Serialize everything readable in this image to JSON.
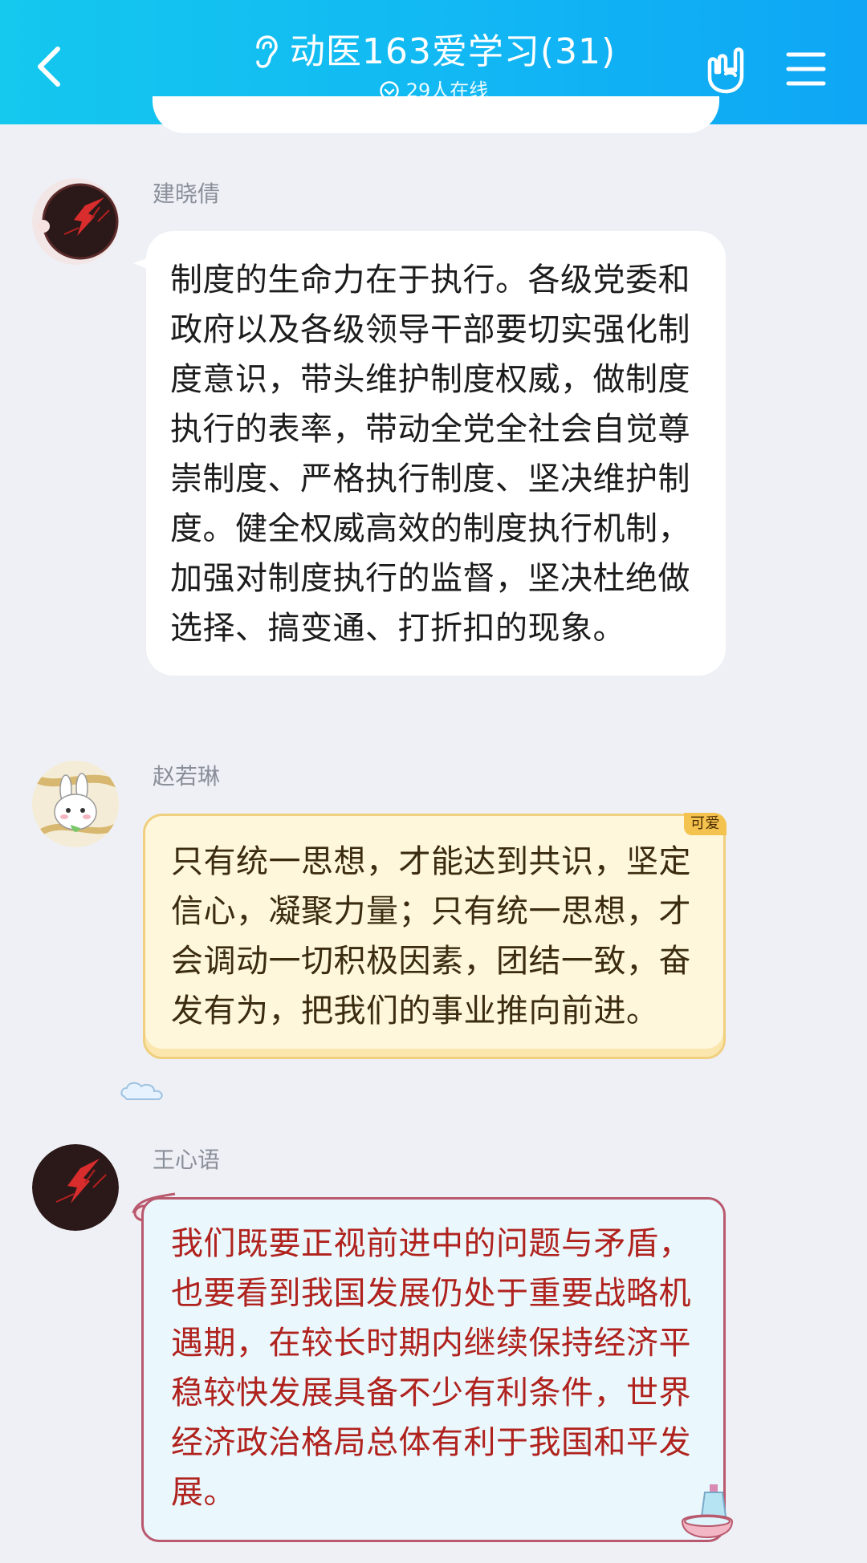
{
  "header": {
    "title": "动医163爱学习(31)",
    "online": "29人在线",
    "colors": {
      "header_start": "#14c8ee",
      "header_end": "#0ea6f5"
    },
    "icons": [
      "back-arrow-icon",
      "ear-icon",
      "online-check-icon",
      "rock-hand-icon",
      "menu-icon"
    ]
  },
  "messages": [
    {
      "sender": "建晓倩",
      "text": "制度的生命力在于执行。各级党委和政府以及各级领导干部要切实强化制度意识，带头维护制度权威，做制度执行的表率，带动全党全社会自觉尊崇制度、严格执行制度、坚决维护制度。健全权威高效的制度执行机制，加强对制度执行的监督，坚决杜绝做选择、搞变通、打折扣的现象。"
    },
    {
      "sender": "赵若琳",
      "tag": "可爱",
      "text": "只有统一思想，才能达到共识，坚定信心，凝聚力量；只有统一思想，才会调动一切积极因素，团结一致，奋发有为，把我们的事业推向前进。"
    },
    {
      "sender": "王心语",
      "text": "我们既要正视前进中的问题与矛盾，也要看到我国发展仍处于重要战略机遇期，在较长时期内继续保持经济平稳较快发展具备不少有利条件，世界经济政治格局总体有利于我国和平发展。"
    }
  ]
}
